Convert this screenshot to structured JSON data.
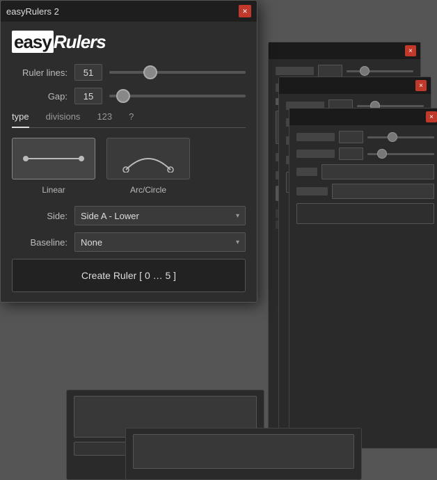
{
  "app": {
    "title": "easyRulers 2",
    "logo_easy": "easy",
    "logo_rulers": "Rulers",
    "close_label": "×"
  },
  "sliders": {
    "ruler_lines_label": "Ruler lines:",
    "ruler_lines_value": "51",
    "gap_label": "Gap:",
    "gap_value": "15"
  },
  "tabs": [
    {
      "id": "type",
      "label": "type",
      "active": true
    },
    {
      "id": "divisions",
      "label": "divisions",
      "active": false
    },
    {
      "id": "123",
      "label": "123",
      "active": false
    },
    {
      "id": "help",
      "label": "?",
      "active": false
    }
  ],
  "type_options": [
    {
      "id": "linear",
      "label": "Linear",
      "selected": true
    },
    {
      "id": "arc",
      "label": "Arc/Circle",
      "selected": false
    }
  ],
  "form": {
    "side_label": "Side:",
    "side_value": "Side A - Lower",
    "baseline_label": "Baseline:",
    "baseline_value": "None"
  },
  "create_button": {
    "label": "Create Ruler [ 0 … 5 ]"
  }
}
